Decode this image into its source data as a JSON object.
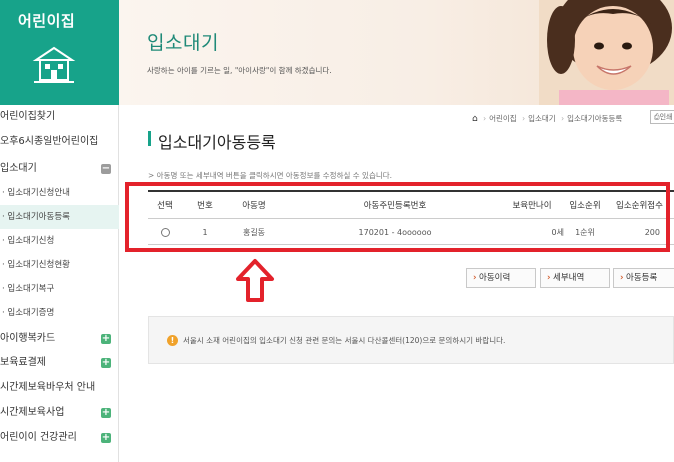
{
  "sidebar": {
    "logo_text": "어린이집",
    "items": [
      {
        "label": "어린이집찾기",
        "type": "main",
        "toggle": ""
      },
      {
        "label": "오후6시종일반어린이집",
        "type": "main",
        "toggle": ""
      },
      {
        "label": "입소대기",
        "type": "main",
        "toggle": "−"
      },
      {
        "label": "· 입소대기신청안내",
        "type": "sub",
        "toggle": ""
      },
      {
        "label": "· 입소대기아동등록",
        "type": "sub",
        "toggle": "",
        "active": true
      },
      {
        "label": "· 입소대기신청",
        "type": "sub",
        "toggle": ""
      },
      {
        "label": "· 입소대기신청현황",
        "type": "sub",
        "toggle": ""
      },
      {
        "label": "· 입소대기복구",
        "type": "sub",
        "toggle": ""
      },
      {
        "label": "· 입소대기증명",
        "type": "sub",
        "toggle": ""
      },
      {
        "label": "아이행복카드",
        "type": "main",
        "toggle": "+"
      },
      {
        "label": "보육료결제",
        "type": "main",
        "toggle": "+"
      },
      {
        "label": "시간제보육바우처 안내",
        "type": "main",
        "toggle": ""
      },
      {
        "label": "시간제보육사업",
        "type": "main",
        "toggle": "+"
      },
      {
        "label": "어린이이 건강관리",
        "type": "main",
        "toggle": "+"
      }
    ]
  },
  "banner": {
    "title": "입소대기",
    "subtitle": "사랑하는 아이를 기르는 일, \"아이사랑\"이 함께 하겠습니다."
  },
  "breadcrumb": {
    "items": [
      "어린이집",
      "입소대기",
      "입소대기아동등록"
    ],
    "print_label": "인쇄"
  },
  "page": {
    "title": "입소대기아동등록",
    "notice": "> 아동명 또는 세부내역 버튼을 클릭하시면 아동정보를 수정하실 수 있습니다."
  },
  "table": {
    "headers": [
      "선택",
      "번호",
      "아동명",
      "아동주민등록번호",
      "보육만나이",
      "입소순위",
      "입소순위점수"
    ],
    "rows": [
      {
        "no": "1",
        "name": "홍길동",
        "rrn": "170201 - 4oooooo",
        "age": "0세",
        "rank": "1순위",
        "score": "200"
      }
    ]
  },
  "buttons": {
    "history": "아동이력",
    "detail": "세부내역",
    "register": "아동등록"
  },
  "info": {
    "text": "서울시 소재 어린이집의 입소대기 신청 관련 문의는 서울시 다산콜센터(120)으로 문의하시기 바랍니다."
  },
  "colors": {
    "brand": "#17a38a",
    "highlight": "#e3222b",
    "info_icon": "#f0a22b"
  }
}
